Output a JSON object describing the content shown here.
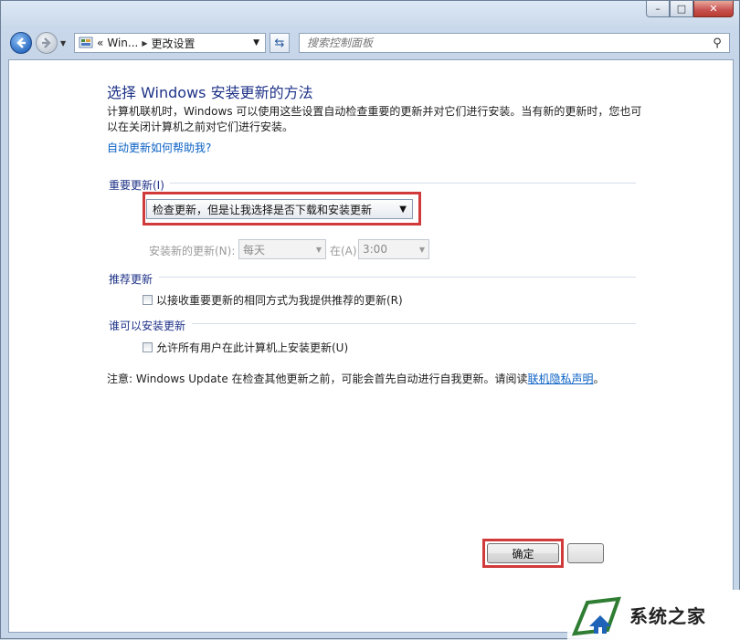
{
  "window": {
    "caption_min": "–",
    "caption_max": "□",
    "caption_close": "✕"
  },
  "nav": {
    "addr_prefix": "«",
    "addr_segment_1": "Win...",
    "addr_segment_2": "更改设置",
    "search_placeholder": "搜索控制面板"
  },
  "page": {
    "title": "选择 Windows 安装更新的方法",
    "description": "计算机联机时，Windows 可以使用这些设置自动检查重要的更新并对它们进行安装。当有新的更新时，您也可以在关闭计算机之前对它们进行安装。",
    "help_link": "自动更新如何帮助我?"
  },
  "important_updates": {
    "label": "重要更新(I)",
    "selected_option": "检查更新，但是让我选择是否下载和安装更新",
    "schedule_label": "安装新的更新(N):",
    "day_value": "每天",
    "at_label": "在(A)",
    "time_value": "3:00"
  },
  "recommended_updates": {
    "label": "推荐更新",
    "checkbox_label": "以接收重要更新的相同方式为我提供推荐的更新(R)",
    "checked": false
  },
  "who_can_install": {
    "label": "谁可以安装更新",
    "checkbox_label": "允许所有用户在此计算机上安装更新(U)",
    "checked": false
  },
  "note": {
    "text": "注意: Windows Update 在检查其他更新之前，可能会首先自动进行自我更新。请阅读",
    "link": "联机隐私声明",
    "suffix": "。"
  },
  "buttons": {
    "ok_label": "确定"
  },
  "watermark": {
    "text": "系统之家"
  },
  "colors": {
    "title_blue": "#1e3287",
    "link_blue": "#0b61c4",
    "highlight_red": "#d13a3a"
  }
}
